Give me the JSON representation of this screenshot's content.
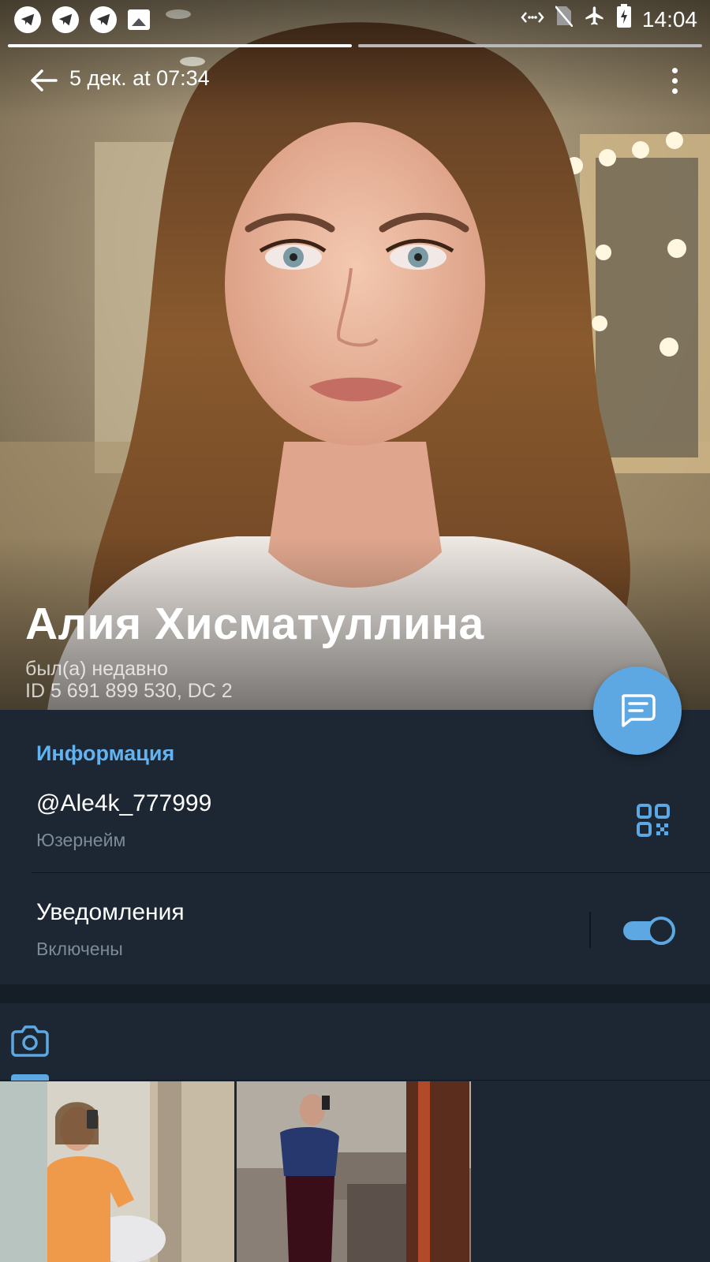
{
  "status_bar": {
    "time": "14:04",
    "notification_icons": [
      "telegram-icon",
      "telegram-icon",
      "telegram-icon",
      "image-icon"
    ],
    "system_icons": [
      "data-transfer-icon",
      "no-sim-icon",
      "airplane-icon",
      "battery-icon"
    ]
  },
  "story": {
    "segments": [
      {
        "state": "viewed",
        "color": "#ffffff"
      },
      {
        "state": "pending",
        "color": "#b9b9b9"
      }
    ]
  },
  "toolbar": {
    "date": "5 дек. at 07:34",
    "back_icon": "arrow-left-icon",
    "menu_icon": "more-vertical-icon"
  },
  "profile": {
    "name": "Алия Хисматуллина",
    "last_seen": "был(а) недавно",
    "id_line": "ID 5 691 899 530, DC 2"
  },
  "fab": {
    "icon": "message-icon",
    "color": "#5da7e2"
  },
  "info": {
    "section_title": "Информация",
    "username": "@Ale4k_777999",
    "username_label": "Юзернейм",
    "qr_icon": "qr-code-icon",
    "notifications_title": "Уведомления",
    "notifications_status": "Включены",
    "notifications_enabled": true
  },
  "media": {
    "active_tab_icon": "camera-icon",
    "items": [
      {
        "name": "photo-orange-sweater"
      },
      {
        "name": "photo-blue-top"
      }
    ]
  },
  "colors": {
    "accent": "#5da7e2",
    "section_title": "#62b3f0",
    "background": "#1d2733",
    "secondary_text": "#7d8b99"
  }
}
